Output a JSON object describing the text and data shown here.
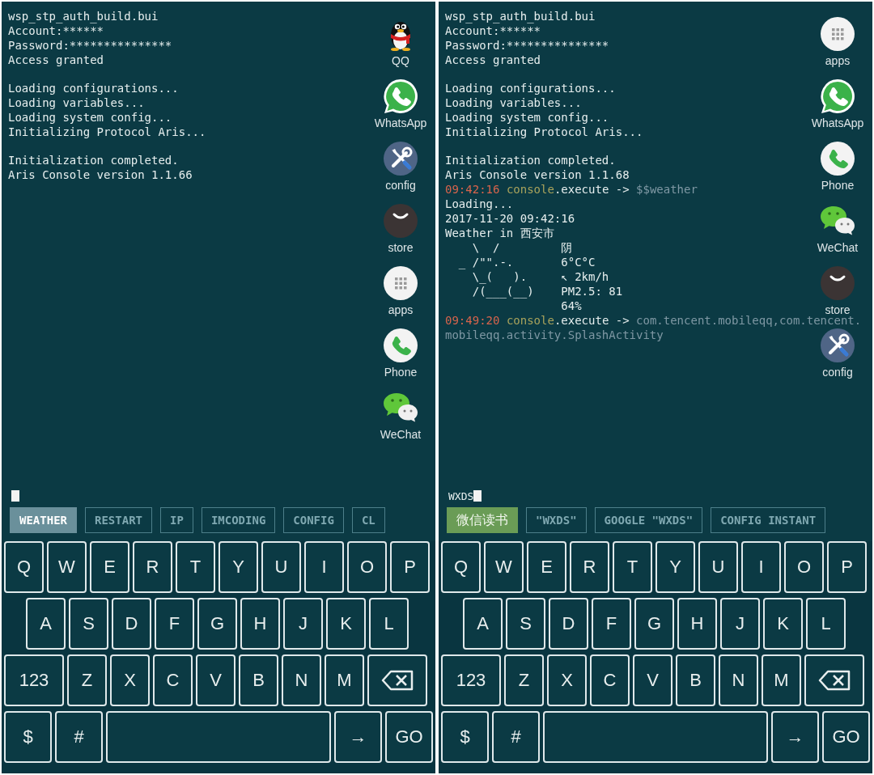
{
  "screens": [
    {
      "console": [
        {
          "kind": "text",
          "text": "wsp_stp_auth_build.bui"
        },
        {
          "kind": "text",
          "text": "Account:******"
        },
        {
          "kind": "text",
          "text": "Password:***************"
        },
        {
          "kind": "text",
          "text": "Access granted"
        },
        {
          "kind": "blank"
        },
        {
          "kind": "text",
          "text": "Loading configurations..."
        },
        {
          "kind": "text",
          "text": "Loading variables..."
        },
        {
          "kind": "text",
          "text": "Loading system config..."
        },
        {
          "kind": "text",
          "text": "Initializing Protocol Aris..."
        },
        {
          "kind": "blank"
        },
        {
          "kind": "text",
          "text": "Initialization completed."
        },
        {
          "kind": "text",
          "text": "Aris Console version 1.1.66"
        }
      ],
      "dock": [
        {
          "label": "QQ",
          "kind": "qq"
        },
        {
          "label": "WhatsApp",
          "kind": "whatsapp"
        },
        {
          "label": "config",
          "kind": "config"
        },
        {
          "label": "store",
          "kind": "store"
        },
        {
          "label": "apps",
          "kind": "apps"
        },
        {
          "label": "Phone",
          "kind": "phone"
        },
        {
          "label": "WeChat",
          "kind": "wechat"
        }
      ],
      "input": {
        "cursor": true
      },
      "suggestions": [
        {
          "label": "WEATHER",
          "kind": "command",
          "selected": true
        },
        {
          "label": "RESTART",
          "kind": "command",
          "selected": false
        },
        {
          "label": "IP",
          "kind": "command",
          "selected": false
        },
        {
          "label": "IMCODING",
          "kind": "command",
          "selected": false
        },
        {
          "label": "CONFIG",
          "kind": "command",
          "selected": false
        },
        {
          "label": "CL",
          "kind": "command",
          "selected": false
        }
      ],
      "keyboard": [
        [
          {
            "label": "Q",
            "kind": "letter"
          },
          {
            "label": "W",
            "kind": "letter"
          },
          {
            "label": "E",
            "kind": "letter"
          },
          {
            "label": "R",
            "kind": "letter"
          },
          {
            "label": "T",
            "kind": "letter"
          },
          {
            "label": "Y",
            "kind": "letter"
          },
          {
            "label": "U",
            "kind": "letter"
          },
          {
            "label": "I",
            "kind": "letter"
          },
          {
            "label": "O",
            "kind": "letter"
          },
          {
            "label": "P",
            "kind": "letter"
          }
        ],
        [
          {
            "label": "A",
            "kind": "letter"
          },
          {
            "label": "S",
            "kind": "letter"
          },
          {
            "label": "D",
            "kind": "letter"
          },
          {
            "label": "F",
            "kind": "letter"
          },
          {
            "label": "G",
            "kind": "letter"
          },
          {
            "label": "H",
            "kind": "letter"
          },
          {
            "label": "J",
            "kind": "letter"
          },
          {
            "label": "K",
            "kind": "letter"
          },
          {
            "label": "L",
            "kind": "letter"
          }
        ],
        [
          {
            "label": "123",
            "kind": "wide"
          },
          {
            "label": "Z",
            "kind": "letter"
          },
          {
            "label": "X",
            "kind": "letter"
          },
          {
            "label": "C",
            "kind": "letter"
          },
          {
            "label": "V",
            "kind": "letter"
          },
          {
            "label": "B",
            "kind": "letter"
          },
          {
            "label": "N",
            "kind": "letter"
          },
          {
            "label": "M",
            "kind": "letter"
          },
          {
            "kind": "backspace"
          }
        ],
        [
          {
            "label": "$",
            "kind": "small"
          },
          {
            "label": "#",
            "kind": "small"
          },
          {
            "kind": "space"
          },
          {
            "label": "→",
            "kind": "small"
          },
          {
            "label": "GO",
            "kind": "small"
          }
        ]
      ]
    },
    {
      "console": [
        {
          "kind": "text",
          "text": "wsp_stp_auth_build.bui"
        },
        {
          "kind": "text",
          "text": "Account:******"
        },
        {
          "kind": "text",
          "text": "Password:***************"
        },
        {
          "kind": "text",
          "text": "Access granted"
        },
        {
          "kind": "blank"
        },
        {
          "kind": "text",
          "text": "Loading configurations..."
        },
        {
          "kind": "text",
          "text": "Loading variables..."
        },
        {
          "kind": "text",
          "text": "Loading system config..."
        },
        {
          "kind": "text",
          "text": "Initializing Protocol Aris..."
        },
        {
          "kind": "blank"
        },
        {
          "kind": "text",
          "text": "Initialization completed."
        },
        {
          "kind": "text",
          "text": "Aris Console version 1.1.68"
        },
        {
          "kind": "command",
          "time": "09:42:16",
          "target": "console",
          "action": ".execute ->",
          "argument": "$$weather"
        },
        {
          "kind": "text",
          "text": "Loading..."
        },
        {
          "kind": "text",
          "text": "2017-11-20 09:42:16"
        },
        {
          "kind": "text",
          "text": "Weather in 西安市"
        },
        {
          "kind": "weather",
          "rows": [
            {
              "art": "    \\  /",
              "value": "阴"
            },
            {
              "art": "  _ /\"\".-.",
              "value": "6°C°C"
            },
            {
              "art": "    \\_(   ).",
              "value": "↖ 2km/h"
            },
            {
              "art": "    /(___(__)",
              "value": "PM2.5: 81"
            },
            {
              "value": "64%"
            }
          ]
        },
        {
          "kind": "command",
          "time": "09:49:20",
          "target": "console",
          "action": ".execute ->",
          "argument": "com.tencent.mobileqq,com.tencent.mobileqq.activity.SplashActivity"
        }
      ],
      "dock": [
        {
          "label": "apps",
          "kind": "apps"
        },
        {
          "label": "WhatsApp",
          "kind": "whatsapp"
        },
        {
          "label": "Phone",
          "kind": "phone"
        },
        {
          "label": "WeChat",
          "kind": "wechat"
        },
        {
          "label": "store",
          "kind": "store"
        },
        {
          "label": "config",
          "kind": "config"
        }
      ],
      "input": {
        "value": "WXDS",
        "cursor": true
      },
      "suggestions": [
        {
          "label": "微信读书",
          "kind": "app",
          "selected": true
        },
        {
          "label": "\"WXDS\"",
          "kind": "command",
          "selected": false
        },
        {
          "label": "GOOGLE \"WXDS\"",
          "kind": "command",
          "selected": false
        },
        {
          "label": "CONFIG INSTANT",
          "kind": "command",
          "selected": false
        }
      ],
      "keyboard": [
        [
          {
            "label": "Q",
            "kind": "letter"
          },
          {
            "label": "W",
            "kind": "letter"
          },
          {
            "label": "E",
            "kind": "letter"
          },
          {
            "label": "R",
            "kind": "letter"
          },
          {
            "label": "T",
            "kind": "letter"
          },
          {
            "label": "Y",
            "kind": "letter"
          },
          {
            "label": "U",
            "kind": "letter"
          },
          {
            "label": "I",
            "kind": "letter"
          },
          {
            "label": "O",
            "kind": "letter"
          },
          {
            "label": "P",
            "kind": "letter"
          }
        ],
        [
          {
            "label": "A",
            "kind": "letter"
          },
          {
            "label": "S",
            "kind": "letter"
          },
          {
            "label": "D",
            "kind": "letter"
          },
          {
            "label": "F",
            "kind": "letter"
          },
          {
            "label": "G",
            "kind": "letter"
          },
          {
            "label": "H",
            "kind": "letter"
          },
          {
            "label": "J",
            "kind": "letter"
          },
          {
            "label": "K",
            "kind": "letter"
          },
          {
            "label": "L",
            "kind": "letter"
          }
        ],
        [
          {
            "label": "123",
            "kind": "wide"
          },
          {
            "label": "Z",
            "kind": "letter"
          },
          {
            "label": "X",
            "kind": "letter"
          },
          {
            "label": "C",
            "kind": "letter"
          },
          {
            "label": "V",
            "kind": "letter"
          },
          {
            "label": "B",
            "kind": "letter"
          },
          {
            "label": "N",
            "kind": "letter"
          },
          {
            "label": "M",
            "kind": "letter"
          },
          {
            "kind": "backspace"
          }
        ],
        [
          {
            "label": "$",
            "kind": "small"
          },
          {
            "label": "#",
            "kind": "small"
          },
          {
            "kind": "space"
          },
          {
            "label": "→",
            "kind": "small"
          },
          {
            "label": "GO",
            "kind": "small"
          }
        ]
      ]
    }
  ]
}
